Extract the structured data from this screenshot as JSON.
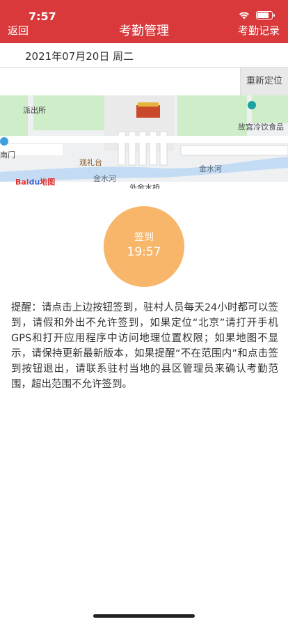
{
  "status_bar": {
    "time": "7:57"
  },
  "nav": {
    "back": "返回",
    "title": "考勤管理",
    "right": "考勤记录"
  },
  "date": {
    "text": "2021年07月20日 周二"
  },
  "relocate_button": "重新定位",
  "map": {
    "labels": {
      "police": "派出所",
      "palace_food": "故宫冷饮食品",
      "south_gate": "南门",
      "guanli": "观礼台",
      "jinshui1": "金水河",
      "jinshui2": "金水河",
      "waijin": "外金水桥",
      "baidu": "Bai",
      "baidu_map": "地图"
    }
  },
  "checkin": {
    "label": "签到",
    "time": "19:57"
  },
  "notice": "提醒：请点击上边按钮签到，驻村人员每天24小时都可以签到，请假和外出不允许签到，如果定位“北京”请打开手机GPS和打开应用程序中访问地理位置权限；如果地图不显示，请保持更新最新版本，如果提醒“不在范围内”和点击签到按钮退出，请联系驻村当地的县区管理员来确认考勤范围，超出范围不允许签到。",
  "colors": {
    "header": "#d9393b",
    "checkin": "#f7b66a",
    "river": "#c3dcf3",
    "park": "#cdeec8"
  }
}
